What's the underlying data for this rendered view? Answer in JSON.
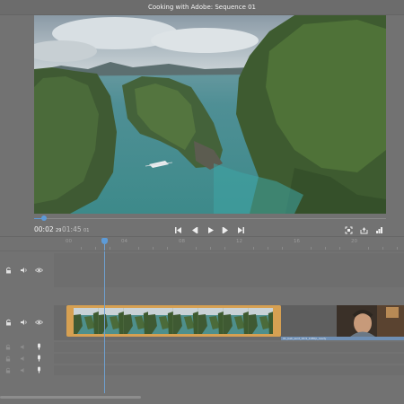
{
  "window": {
    "title": "Cooking with Adobe: Sequence 01"
  },
  "monitor": {
    "current_time": "00:02",
    "current_frames": "29",
    "total_time": "01:45",
    "total_frames": "01",
    "playhead_progress": 0.03
  },
  "transport": {
    "buttons": [
      "step-back-to-start",
      "step-back-frame",
      "play",
      "step-forward-frame",
      "step-forward-to-end"
    ],
    "right_buttons": [
      "fit-icon",
      "export-frame-icon",
      "settings-icon"
    ]
  },
  "timeline": {
    "ruler_labels": [
      "00",
      "04",
      "08",
      "12",
      "16",
      "20"
    ],
    "playhead_position_seconds": 2.97,
    "tracks": [
      {
        "id": "v2",
        "icons": [
          "lock-icon",
          "speaker-icon",
          "eye-icon"
        ]
      },
      {
        "id": "v1",
        "icons": [
          "lock-icon",
          "speaker-icon",
          "eye-icon"
        ]
      },
      {
        "id": "a1",
        "icons": [
          "lock-icon",
          "speaker-icon",
          "mic-icon"
        ]
      },
      {
        "id": "a2",
        "icons": [
          "lock-icon",
          "speaker-icon",
          "mic-icon"
        ]
      },
      {
        "id": "a3",
        "icons": [
          "lock-icon",
          "speaker-icon",
          "mic-icon"
        ]
      }
    ],
    "clips": {
      "main_label": "",
      "blue_label": "01_bab_sent_16:9_1080p_ready"
    }
  },
  "colors": {
    "accent": "#5d9bd8",
    "clip_selected": "#d6a052",
    "panel": "#727272"
  }
}
